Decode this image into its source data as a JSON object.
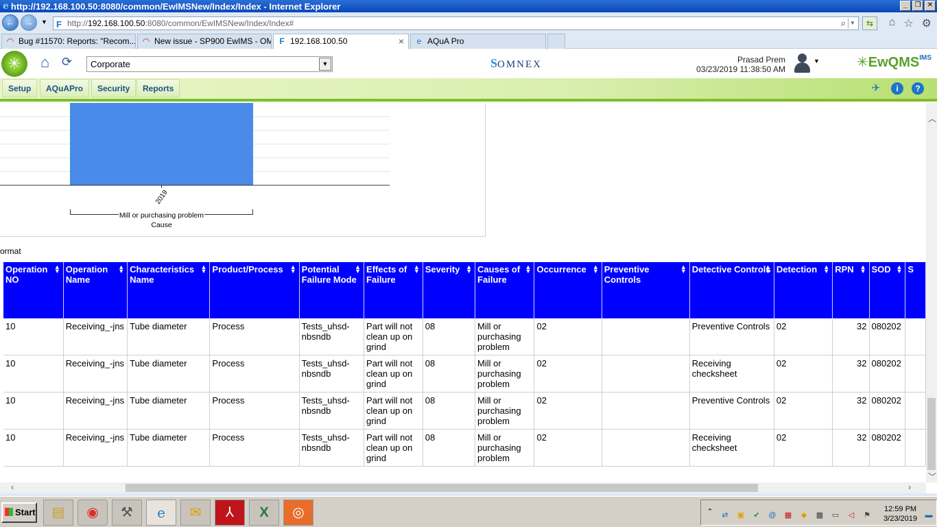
{
  "browser": {
    "title": "http://192.168.100.50:8080/common/EwIMSNew/Index/Index - Internet Explorer",
    "address_prefix": "http://",
    "address_host": "192.168.100.50",
    "address_rest": ":8080/common/EwIMSNew/Index/Index#",
    "tabs": [
      {
        "label": "Bug #11570: Reports: \"Recom...",
        "icon": "redmine-icon"
      },
      {
        "label": "New issue - SP900 EwIMS - OM...",
        "icon": "redmine-icon"
      },
      {
        "label": "192.168.100.50",
        "icon": "omnex-icon",
        "active": true
      },
      {
        "label": "AQuA Pro",
        "icon": "ie-icon"
      }
    ]
  },
  "app": {
    "plant": "Corporate",
    "brand": "OMNEX",
    "user_name": "Prasad Prem",
    "datetime": "03/23/2019 11:38:50 AM",
    "product": "EwQMS",
    "product_sup": "IMS",
    "menu": [
      "Setup",
      "AQuAPro",
      "Security",
      "Reports"
    ]
  },
  "chart_data": {
    "type": "bar",
    "categories": [
      "2019"
    ],
    "values": [
      1
    ],
    "group_label": "Mill or purchasing problem",
    "xlabel": "Cause",
    "ylabel": "",
    "title": ""
  },
  "format_label": "ormat",
  "table": {
    "columns": [
      "Operation NO",
      "Operation Name",
      "Characteristics Name",
      "Product/Process",
      "Potential Failure Mode",
      "Effects of Failure",
      "Severity",
      "Causes of Failure",
      "Occurrence",
      "Preventive Controls",
      "Detective Controls",
      "Detection",
      "RPN",
      "SOD",
      "S"
    ],
    "rows": [
      [
        "10",
        "Receiving_-jns",
        "Tube diameter",
        "Process",
        "Tests_uhsd-nbsndb",
        "Part will not clean up on grind",
        "08",
        "Mill or purchasing problem",
        "02",
        "",
        "Preventive Controls",
        "02",
        "32",
        "080202",
        ""
      ],
      [
        "10",
        "Receiving_-jns",
        "Tube diameter",
        "Process",
        "Tests_uhsd-nbsndb",
        "Part will not clean up on grind",
        "08",
        "Mill or purchasing problem",
        "02",
        "",
        "Receiving checksheet",
        "02",
        "32",
        "080202",
        ""
      ],
      [
        "10",
        "Receiving_-jns",
        "Tube diameter",
        "Process",
        "Tests_uhsd-nbsndb",
        "Part will not clean up on grind",
        "08",
        "Mill or purchasing problem",
        "02",
        "",
        "Preventive Controls",
        "02",
        "32",
        "080202",
        ""
      ],
      [
        "10",
        "Receiving_-jns",
        "Tube diameter",
        "Process",
        "Tests_uhsd-nbsndb",
        "Part will not clean up on grind",
        "08",
        "Mill or purchasing problem",
        "02",
        "",
        "Receiving checksheet",
        "02",
        "32",
        "080202",
        ""
      ]
    ]
  },
  "taskbar": {
    "start_label": "Start",
    "time": "12:59 PM",
    "date": "3/23/2019"
  },
  "colors": {
    "header_blue": "#0000ff",
    "bar_blue": "#4a8bea",
    "menu_green": "#7cbf27"
  }
}
